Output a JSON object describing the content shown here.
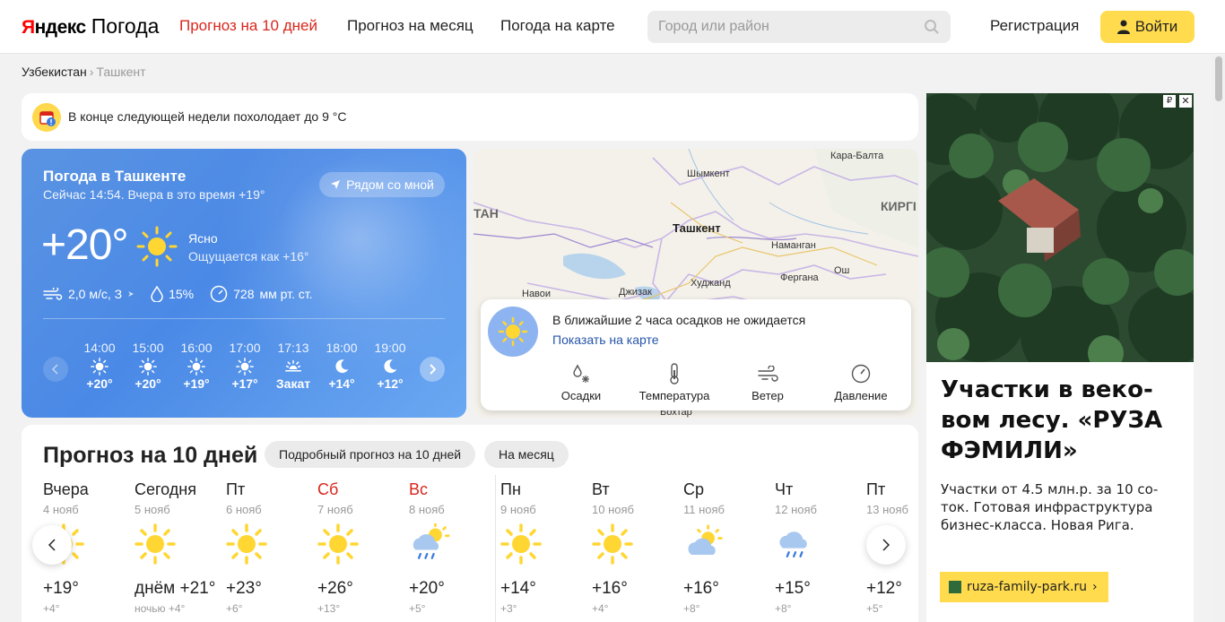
{
  "header": {
    "logo_ya": "Я",
    "logo_ndex": "ндекс",
    "logo_pogoda": "Погода",
    "nav": [
      "Прогноз на 10 дней",
      "Прогноз на месяц",
      "Погода на карте"
    ],
    "search_placeholder": "Город или район",
    "register": "Регистрация",
    "login": "Войти"
  },
  "breadcrumb": {
    "country": "Узбекистан",
    "sep": "›",
    "city": "Ташкент"
  },
  "alert": {
    "text": "В конце следующей недели похолодает до 9 °C"
  },
  "current": {
    "title": "Погода в Ташкенте",
    "subtitle_prefix": "Сейчас 14:54. Вчера в это время ",
    "subtitle_temp": "+19°",
    "nearby": "Рядом со мной",
    "temp": "+20°",
    "condition": "Ясно",
    "feels_prefix": "Ощущается как ",
    "feels_temp": "+16°",
    "wind": "2,0 м/с, З",
    "humidity": "15%",
    "pressure_value": "728",
    "pressure_unit": "мм рт. ст.",
    "hourly": [
      {
        "time": "14:00",
        "icon": "sun-icon",
        "value": "+20°"
      },
      {
        "time": "15:00",
        "icon": "sun-icon",
        "value": "+20°"
      },
      {
        "time": "16:00",
        "icon": "sun-icon",
        "value": "+19°"
      },
      {
        "time": "17:00",
        "icon": "sun-icon",
        "value": "+17°"
      },
      {
        "time": "17:13",
        "icon": "sunset-icon",
        "value": "Закат"
      },
      {
        "time": "18:00",
        "icon": "moon-icon",
        "value": "+14°"
      },
      {
        "time": "19:00",
        "icon": "moon-icon",
        "value": "+12°"
      }
    ]
  },
  "map": {
    "labels": [
      "Кара-Балта",
      "Шымкент",
      "ТАН",
      "Ташкент",
      "КИРГІ",
      "Наманган",
      "Фергана",
      "Ош",
      "Навои",
      "Джизак",
      "Худжанд",
      "Бохтар"
    ],
    "precip_message": "В ближайшие 2 часа осадков не ожидается",
    "precip_link": "Показать на карте",
    "layers": [
      "Осадки",
      "Температура",
      "Ветер",
      "Давление"
    ]
  },
  "forecast": {
    "title": "Прогноз на 10 дней",
    "pill_detailed": "Подробный прогноз на 10 дней",
    "pill_month": "На месяц",
    "days": [
      {
        "name": "Вчера",
        "date": "4 нояб",
        "icon": "sun-icon",
        "day": "+19°",
        "night": "+4°",
        "weekend": false
      },
      {
        "name": "Сегодня",
        "date": "5 нояб",
        "icon": "sun-icon",
        "day": "днём +21°",
        "night": "ночью +4°",
        "weekend": false
      },
      {
        "name": "Пт",
        "date": "6 нояб",
        "icon": "sun-icon",
        "day": "+23°",
        "night": "+6°",
        "weekend": false
      },
      {
        "name": "Сб",
        "date": "7 нояб",
        "icon": "sun-icon",
        "day": "+26°",
        "night": "+13°",
        "weekend": true
      },
      {
        "name": "Вс",
        "date": "8 нояб",
        "icon": "partly-rain-icon",
        "day": "+20°",
        "night": "+5°",
        "weekend": true
      },
      {
        "name": "Пн",
        "date": "9 нояб",
        "icon": "sun-icon",
        "day": "+14°",
        "night": "+3°",
        "weekend": false
      },
      {
        "name": "Вт",
        "date": "10 нояб",
        "icon": "sun-icon",
        "day": "+16°",
        "night": "+4°",
        "weekend": false
      },
      {
        "name": "Ср",
        "date": "11 нояб",
        "icon": "partly-cloudy-icon",
        "day": "+16°",
        "night": "+8°",
        "weekend": false
      },
      {
        "name": "Чт",
        "date": "12 нояб",
        "icon": "rain-icon",
        "day": "+15°",
        "night": "+8°",
        "weekend": false
      },
      {
        "name": "Пт",
        "date": "13 нояб",
        "icon": "rain-icon",
        "day": "+12°",
        "night": "+5°",
        "weekend": false
      }
    ]
  },
  "ad": {
    "rub": "₽",
    "close": "✕",
    "headline": "Участки в веко-вом лесу. «РУЗА ФЭМИЛИ»",
    "body": "Участки от 4.5 млн.р. за 10 со-ток. Готовая инфраструктура бизнес-класса. Новая Рига.",
    "cta": "ruza-family-park.ru",
    "cta_arrow": "›"
  },
  "colors": {
    "accent": "#d8261c",
    "yellow": "#ffdb4d",
    "blue": "#4a89e6",
    "link": "#2655a8"
  }
}
